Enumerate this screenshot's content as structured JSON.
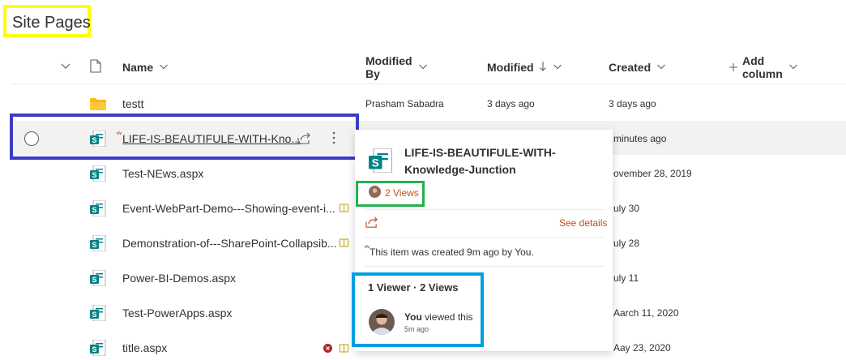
{
  "page": {
    "title": "Site Pages"
  },
  "columns": {
    "name": "Name",
    "modified_by": "Modified By",
    "modified": "Modified",
    "created": "Created",
    "add_column": "Add column"
  },
  "rows": [
    {
      "name": "testt",
      "modified_by": "Prasham Sabadra",
      "modified": "3 days ago",
      "created": "3 days ago"
    },
    {
      "name": "LIFE-IS-BEAUTIFULE-WITH-Kno...",
      "created": "minutes ago"
    },
    {
      "name": "Test-NEws.aspx",
      "created": "ovember 28, 2019"
    },
    {
      "name": "Event-WebPart-Demo---Showing-event-i...",
      "created": "uly 30"
    },
    {
      "name": "Demonstration-of---SharePoint-Collapsib...",
      "created": "uly 28"
    },
    {
      "name": "Power-BI-Demos.aspx",
      "created": "uly 11"
    },
    {
      "name": "Test-PowerApps.aspx",
      "created": "Aarch 11, 2020"
    },
    {
      "name": "title.aspx",
      "created": "Aay 23, 2020"
    }
  ],
  "card": {
    "title": "LIFE-IS-BEAUTIFULE-WITH-Knowledge-Junction",
    "views": "2 Views",
    "see_details": "See details",
    "created_note": "This item was created 9m ago by You.",
    "viewer_stats": "1 Viewer · 2 Views",
    "you": "You",
    "viewed_this": "viewed this",
    "ago": "5m ago"
  },
  "colors": {
    "accent_orange": "#c74b19",
    "sharepoint_green": "#038387",
    "annot_yellow": "#ffff00",
    "annot_blue": "#3b3ec4",
    "annot_green": "#21b24b",
    "annot_cyan": "#009fe3"
  },
  "icons": {
    "file_type": "sharepoint-page-icon",
    "folder": "folder-icon",
    "share": "share-icon",
    "more": "more-icon",
    "new_indicator": "new-spark-icon"
  }
}
